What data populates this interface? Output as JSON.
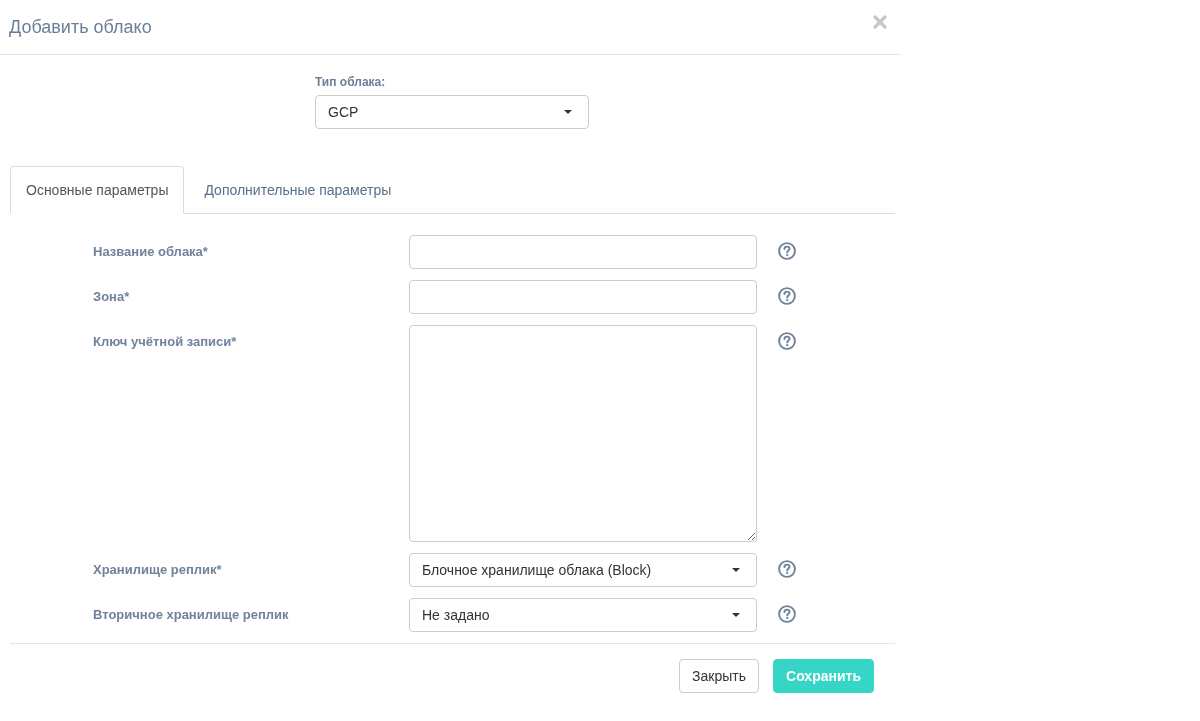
{
  "dialog": {
    "title": "Добавить облако"
  },
  "cloud_type": {
    "label": "Тип облака:",
    "value": "GCP"
  },
  "tabs": [
    {
      "label": "Основные параметры",
      "selected": true
    },
    {
      "label": "Дополнительные параметры",
      "selected": false
    }
  ],
  "fields": [
    {
      "kind": "input",
      "label": "Название облака*"
    },
    {
      "kind": "input",
      "label": "Зона*"
    },
    {
      "kind": "textarea",
      "label": "Ключ учётной записи*"
    },
    {
      "kind": "select",
      "label": "Хранилище реплик*",
      "value": "Блочное хранилище облака (Block)"
    },
    {
      "kind": "select",
      "label": "Вторичное хранилище реплик",
      "value": "Не задано"
    }
  ],
  "buttons": [
    {
      "label": "Закрыть",
      "kind": "default"
    },
    {
      "label": "Сохранить",
      "kind": "primary"
    }
  ]
}
